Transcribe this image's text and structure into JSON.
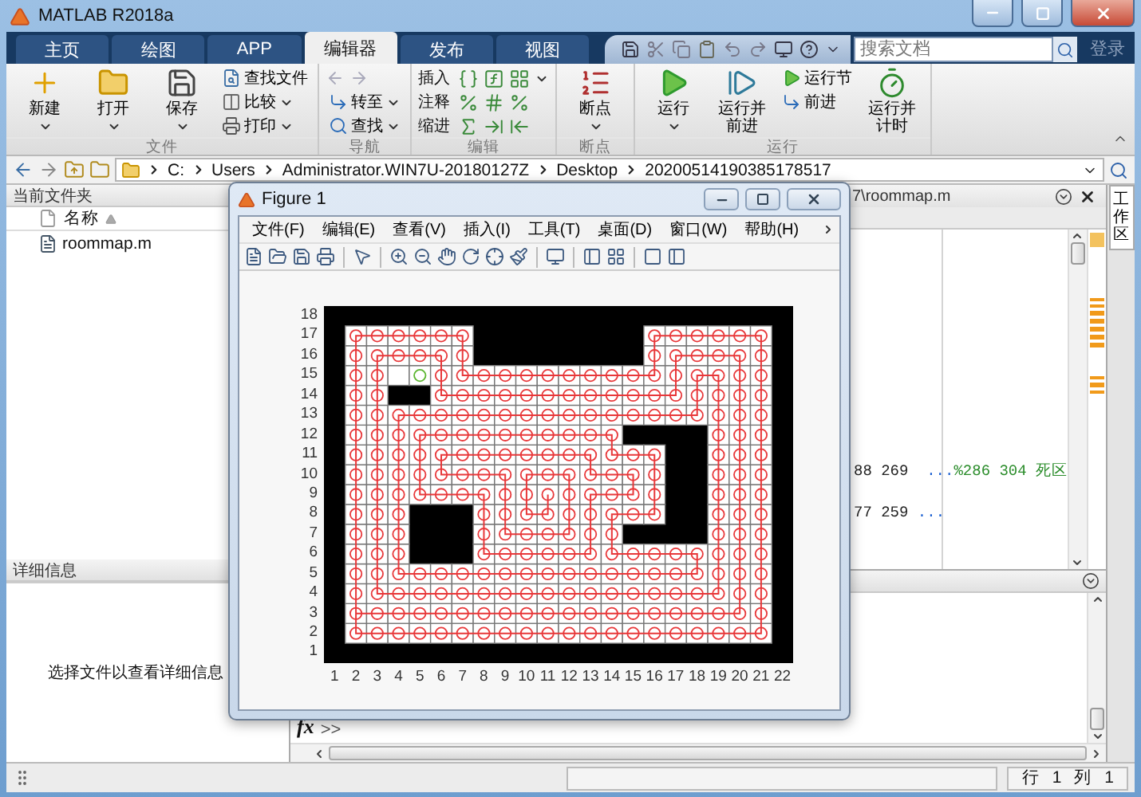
{
  "window": {
    "title": "MATLAB R2018a"
  },
  "tabs": [
    {
      "label": "主页",
      "selected": false
    },
    {
      "label": "绘图",
      "selected": false
    },
    {
      "label": "APP",
      "selected": false
    },
    {
      "label": "编辑器",
      "selected": true
    },
    {
      "label": "发布",
      "selected": false
    },
    {
      "label": "视图",
      "selected": false
    }
  ],
  "search": {
    "placeholder": "搜索文档"
  },
  "login": "登录",
  "ribbon": {
    "groups": [
      {
        "label": "文件",
        "kind": "file",
        "items": [
          {
            "kind": "large",
            "label": "新建",
            "dropdown": true
          },
          {
            "kind": "large",
            "label": "打开",
            "dropdown": true
          },
          {
            "kind": "large",
            "label": "保存",
            "dropdown": true
          },
          {
            "kind": "small",
            "label": "查找文件",
            "dropdown": false
          },
          {
            "kind": "small",
            "label": "比较",
            "dropdown": true
          },
          {
            "kind": "small",
            "label": "打印",
            "dropdown": true
          }
        ]
      },
      {
        "label": "导航",
        "kind": "navigate",
        "items": [
          {
            "kind": "small",
            "label": "转至",
            "dropdown": true
          },
          {
            "kind": "small",
            "label": "查找",
            "dropdown": true
          }
        ]
      },
      {
        "label": "编辑",
        "kind": "edit",
        "items": [
          {
            "kind": "edit",
            "label": "插入",
            "dropdown": true
          },
          {
            "kind": "edit",
            "label": "注释",
            "dropdown": false
          },
          {
            "kind": "edit",
            "label": "缩进",
            "dropdown": false
          }
        ]
      },
      {
        "label": "断点",
        "kind": "breakpoint",
        "items": [
          {
            "kind": "large",
            "label": "断点",
            "dropdown": true
          }
        ]
      },
      {
        "label": "运行",
        "kind": "run",
        "items": [
          {
            "kind": "large",
            "label": "运行",
            "dropdown": true
          },
          {
            "kind": "large",
            "label": "运行并前进",
            "dropdown": false
          },
          {
            "kind": "small",
            "label": "运行节",
            "dropdown": false
          },
          {
            "kind": "small",
            "label": "前进",
            "dropdown": false
          },
          {
            "kind": "large",
            "label": "运行并计时",
            "dropdown": false
          }
        ]
      }
    ]
  },
  "address": {
    "path": [
      "C:",
      "Users",
      "Administrator.WIN7U-20180127Z",
      "Desktop",
      "20200514190385178517"
    ]
  },
  "current_folder": {
    "title": "当前文件夹",
    "column": "名称",
    "files": [
      "roommap.m"
    ]
  },
  "details": {
    "title": "详细信息",
    "hint": "选择文件以查看详细信息"
  },
  "editor": {
    "tab": "7\\roommap.m",
    "lines": [
      {
        "segments": [
          {
            "kind": "code",
            "text": "88 269  "
          },
          {
            "kind": "continuation",
            "text": "..."
          },
          {
            "kind": "comment",
            "text": "%286 304 死区"
          }
        ]
      },
      {
        "segments": [
          {
            "kind": "code",
            "text": "77 259 "
          },
          {
            "kind": "continuation",
            "text": "..."
          }
        ]
      }
    ]
  },
  "workspace_tab": "工作区",
  "command": {
    "fx": "fx",
    "prompt": ">>"
  },
  "figure": {
    "title": "Figure 1",
    "menus": [
      "文件(F)",
      "编辑(E)",
      "查看(V)",
      "插入(I)",
      "工具(T)",
      "桌面(D)",
      "窗口(W)",
      "帮助(H)"
    ],
    "y_ticks": [
      "18",
      "17",
      "16",
      "15",
      "14",
      "13",
      "12",
      "11",
      "10",
      "9",
      "8",
      "7",
      "6",
      "5",
      "4",
      "3",
      "2",
      "1"
    ],
    "x_ticks": [
      "1",
      "2",
      "3",
      "4",
      "5",
      "6",
      "7",
      "8",
      "9",
      "10",
      "11",
      "12",
      "13",
      "14",
      "15",
      "16",
      "17",
      "18",
      "19",
      "20",
      "21",
      "22"
    ]
  },
  "status": {
    "row_label": "行",
    "row": "1",
    "col_label": "列",
    "col": "1"
  }
}
